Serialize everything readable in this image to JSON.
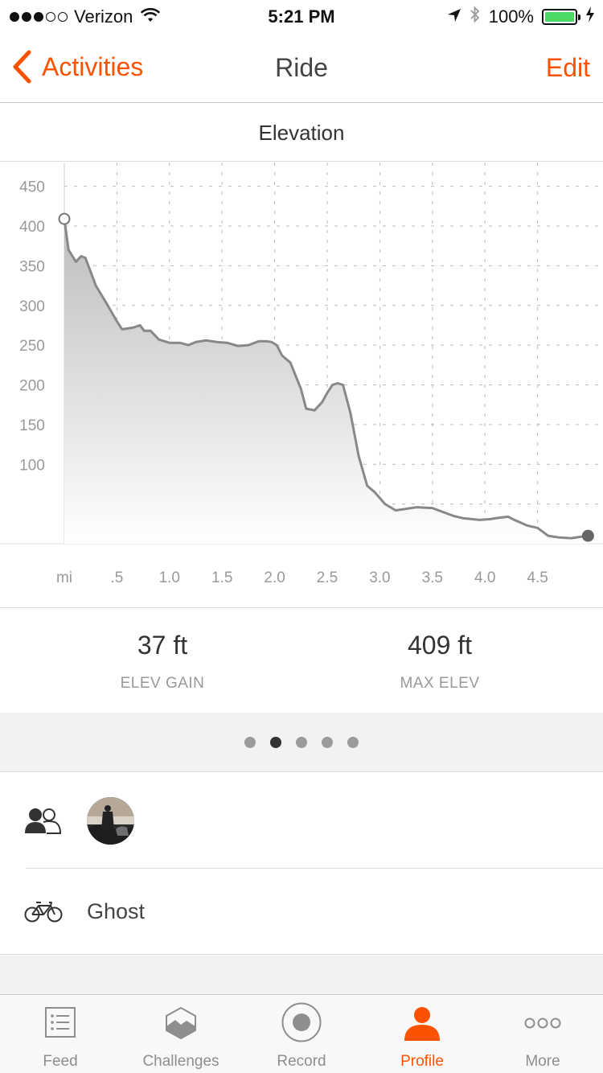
{
  "status_bar": {
    "carrier": "Verizon",
    "time": "5:21 PM",
    "battery": "100%",
    "signal_filled": 3,
    "signal_total": 5
  },
  "nav": {
    "back_label": "Activities",
    "title": "Ride",
    "edit_label": "Edit"
  },
  "section": {
    "title": "Elevation"
  },
  "chart_data": {
    "type": "area",
    "title": "Elevation",
    "xlabel": "mi",
    "ylabel": "",
    "xlim": [
      0,
      5.0
    ],
    "ylim": [
      0,
      480
    ],
    "y_ticks": [
      100,
      150,
      200,
      250,
      300,
      350,
      400,
      450
    ],
    "y_grid_extra": [
      0,
      50
    ],
    "x_ticks": [
      0.5,
      1.0,
      1.5,
      2.0,
      2.5,
      3.0,
      3.5,
      4.0,
      4.5
    ],
    "x_tick_labels": [
      ".5",
      "1.0",
      "1.5",
      "2.0",
      "2.5",
      "3.0",
      "3.5",
      "4.0",
      "4.5"
    ],
    "x_axis_unit_label": "mi",
    "grid": true,
    "series": [
      {
        "x": [
          0,
          0.04,
          0.11,
          0.16,
          0.2,
          0.3,
          0.4,
          0.5,
          0.55,
          0.65,
          0.72,
          0.76,
          0.82,
          0.9,
          1.0,
          1.1,
          1.18,
          1.25,
          1.35,
          1.45,
          1.55,
          1.65,
          1.75,
          1.85,
          1.92,
          1.97,
          2.02,
          2.07,
          2.15,
          2.25,
          2.3,
          2.38,
          2.45,
          2.5,
          2.55,
          2.6,
          2.65,
          2.72,
          2.8,
          2.88,
          2.95,
          3.05,
          3.15,
          3.25,
          3.35,
          3.5,
          3.6,
          3.7,
          3.8,
          3.95,
          4.05,
          4.15,
          4.22,
          4.28,
          4.4,
          4.5,
          4.6,
          4.7,
          4.82,
          4.92,
          4.98
        ],
        "y": [
          409,
          370,
          355,
          362,
          360,
          325,
          303,
          280,
          270,
          272,
          275,
          268,
          268,
          257,
          253,
          253,
          250,
          254,
          256,
          254,
          253,
          249,
          250,
          255,
          255,
          254,
          250,
          237,
          228,
          195,
          170,
          168,
          178,
          190,
          200,
          202,
          200,
          165,
          110,
          73,
          65,
          50,
          42,
          44,
          46,
          45,
          40,
          35,
          32,
          30,
          31,
          33,
          34,
          30,
          23,
          20,
          10,
          8,
          7,
          9,
          10
        ],
        "color": "#888888"
      }
    ],
    "start_marker": "open-circle",
    "end_marker": "filled-circle"
  },
  "stats": {
    "elev_gain_value": "37 ft",
    "elev_gain_label": "ELEV GAIN",
    "max_elev_value": "409 ft",
    "max_elev_label": "MAX ELEV"
  },
  "pager": {
    "count": 5,
    "active_index": 1
  },
  "gear": {
    "name": "Ghost"
  },
  "tabs": [
    {
      "label": "Feed",
      "icon": "feed-icon"
    },
    {
      "label": "Challenges",
      "icon": "challenges-icon"
    },
    {
      "label": "Record",
      "icon": "record-icon"
    },
    {
      "label": "Profile",
      "icon": "profile-icon"
    },
    {
      "label": "More",
      "icon": "more-icon"
    }
  ],
  "colors": {
    "accent": "#fc5200",
    "chart_line": "#888888",
    "battery": "#4cd964"
  }
}
